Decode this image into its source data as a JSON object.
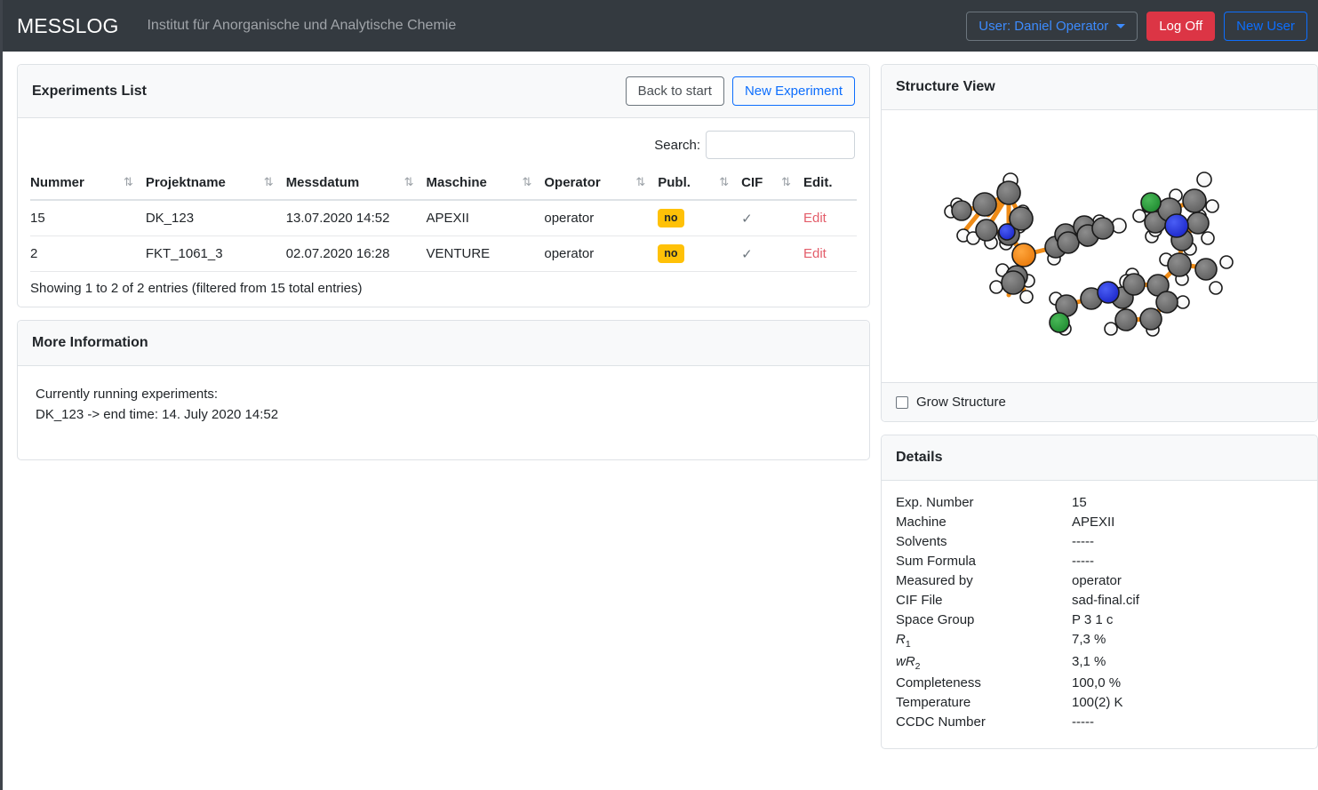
{
  "navbar": {
    "brand": "MESSLOG",
    "subtitle": "Institut für Anorganische und Analytische Chemie",
    "user_button": "User: Daniel Operator",
    "logoff_button": "Log Off",
    "newuser_button": "New User",
    "colors": {
      "bg": "#343a40",
      "danger": "#dc3545",
      "primary": "#0d6efd"
    }
  },
  "experiments_card": {
    "title": "Experiments List",
    "back_button": "Back to start",
    "new_experiment_button": "New Experiment",
    "search_label": "Search:",
    "search_value": "",
    "search_placeholder": "",
    "columns": [
      {
        "label": "Nummer",
        "sort": "⇅"
      },
      {
        "label": "Projektname",
        "sort": "⇅"
      },
      {
        "label": "Messdatum",
        "sort": "⇅"
      },
      {
        "label": "Maschine",
        "sort": "⇅"
      },
      {
        "label": "Operator",
        "sort": "⇅"
      },
      {
        "label": "Publ.",
        "sort": "⇅"
      },
      {
        "label": "CIF",
        "sort": "⇅"
      },
      {
        "label": "Edit.",
        "sort": ""
      }
    ],
    "rows": [
      {
        "nummer": "15",
        "projektname": "DK_123",
        "messdatum": "13.07.2020 14:52",
        "maschine": "APEXII",
        "operator": "operator",
        "publ": "no",
        "cif": "✓",
        "edit": "Edit"
      },
      {
        "nummer": "2",
        "projektname": "FKT_1061_3",
        "messdatum": "02.07.2020 16:28",
        "maschine": "VENTURE",
        "operator": "operator",
        "publ": "no",
        "cif": "✓",
        "edit": "Edit"
      }
    ],
    "info": "Showing 1 to 2 of 2 entries (filtered from 15 total entries)",
    "badge_color": "#ffc107",
    "edit_link_color": "#e35d6a"
  },
  "more_information": {
    "title": "More Information",
    "line1": "Currently running experiments:",
    "line2": "DK_123 -> end time: 14. July 2020 14:52"
  },
  "structure_view": {
    "title": "Structure View",
    "grow_label": "Grow Structure",
    "grow_checked": false,
    "atom_colors": {
      "carbon": "#666666",
      "hydrogen": "#ffffff",
      "nitrogen": "#2233dd",
      "chlorine": "#2e9e3e",
      "phosphorus": "#ef8b16",
      "bond": "#ef8b16"
    }
  },
  "details": {
    "title": "Details",
    "rows": [
      {
        "key": "Exp. Number",
        "value": "15"
      },
      {
        "key": "Machine",
        "value": "APEXII"
      },
      {
        "key": "Solvents",
        "value": "-----"
      },
      {
        "key": "Sum Formula",
        "value": "-----"
      },
      {
        "key": "Measured by",
        "value": "operator"
      },
      {
        "key": "CIF File",
        "value": "sad-final.cif"
      },
      {
        "key": "Space Group",
        "value": "P 3 1 c"
      },
      {
        "key": "R1",
        "value": "7,3 %"
      },
      {
        "key": "wR2",
        "value": "3,1 %"
      },
      {
        "key": "Completeness",
        "value": "100,0 %"
      },
      {
        "key": "Temperature",
        "value": "100(2) K"
      },
      {
        "key": "CCDC Number",
        "value": "-----"
      }
    ]
  }
}
